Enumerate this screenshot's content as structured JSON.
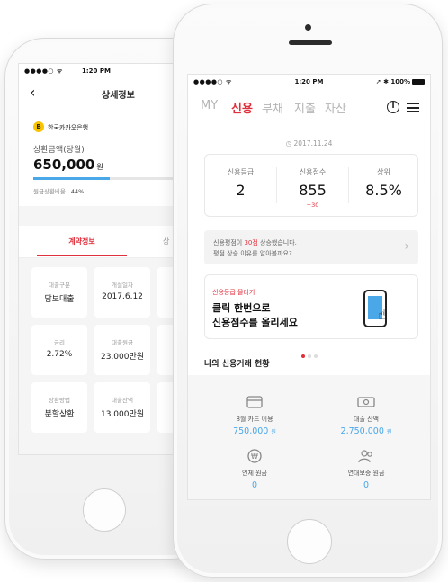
{
  "back": {
    "status": {
      "left": "●●●●○ ᯤ",
      "time": "1:20 PM"
    },
    "header": {
      "back_glyph": "‹",
      "title": "상세정보"
    },
    "bank": {
      "badge": "B",
      "name": "한국카카오은행"
    },
    "amount_label": "상환금액(당월)",
    "amount": "650,000",
    "amount_unit": "원",
    "progress": 0.44,
    "rate_label": "원금상환비율",
    "rate_value": "44%",
    "tabs": {
      "active": "계약정보",
      "other": "상"
    },
    "cards": [
      {
        "key": "대출구분",
        "value": "담보대출"
      },
      {
        "key": "개설일자",
        "value": "2017.6.12"
      },
      {
        "key": "금리",
        "value": "2.72%"
      },
      {
        "key": "대출원금",
        "value": "23,000만원"
      },
      {
        "key": "상환방법",
        "value": "분할상환"
      },
      {
        "key": "대출잔액",
        "value": "13,000만원"
      }
    ]
  },
  "front": {
    "status": {
      "left": "●●●●○ ᯤ",
      "time": "1:20 PM",
      "right": "➚ ✱ 100%"
    },
    "nav": {
      "tabs": [
        "MY",
        "신용",
        "부채",
        "지출",
        "자산"
      ],
      "active_index": 1,
      "info_glyph": "i"
    },
    "date": "◷ 2017.11.24",
    "stats": [
      {
        "key": "신용등급",
        "value": "2",
        "delta": ""
      },
      {
        "key": "신용점수",
        "value": "855",
        "delta": "+30"
      },
      {
        "key": "상위",
        "value": "8.5%",
        "delta": ""
      }
    ],
    "notice": {
      "prefix": "신용평점이 ",
      "highlight": "30점",
      "suffix": " 상승했습니다.",
      "line2": "평점 상승 이유를 알아볼까요?",
      "arrow": "›"
    },
    "banner": {
      "tag": "신용등급 올리기",
      "line1": "클릭 한번으로",
      "line2": "신용점수를 올리세요"
    },
    "section_title": "나의 신용거래 현황",
    "summary": [
      {
        "key": "8월 카드 이용",
        "value": "750,000",
        "unit": "원",
        "icon": "card-icon"
      },
      {
        "key": "대출 잔액",
        "value": "2,750,000",
        "unit": "원",
        "icon": "cash-icon"
      },
      {
        "key": "연체 원금",
        "value": "0",
        "unit": "",
        "icon": "won-icon"
      },
      {
        "key": "연대보증 원금",
        "value": "0",
        "unit": "",
        "icon": "people-icon"
      }
    ]
  },
  "colors": {
    "accent_red": "#e0303d",
    "accent_blue": "#4aa7e8",
    "bank_yellow": "#f8c400"
  }
}
